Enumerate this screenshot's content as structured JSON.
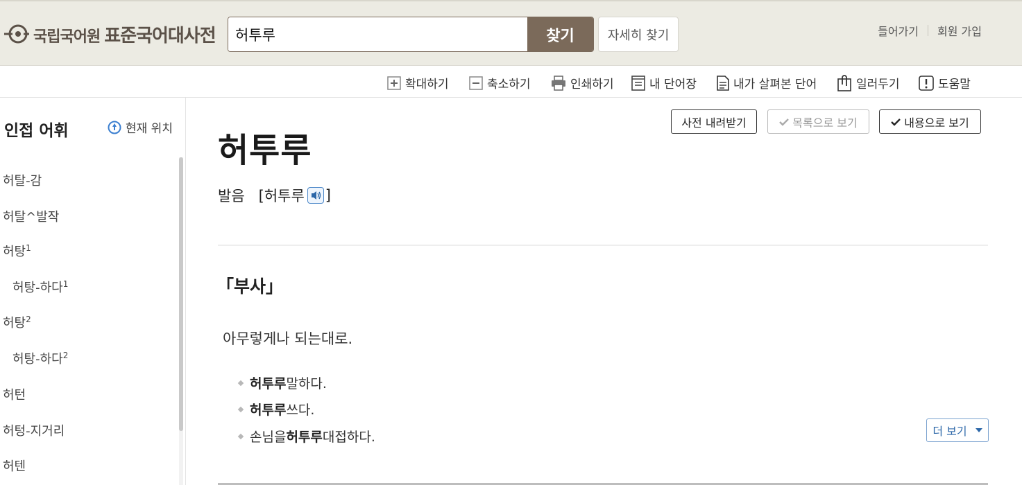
{
  "header": {
    "logo_org": "국립국어원",
    "logo_title": "표준국어대사전",
    "search_value": "허투루",
    "search_button": "찾기",
    "detail_search": "자세히 찾기",
    "login": "들어가기",
    "signup": "회원 가입"
  },
  "toolbar": {
    "zoom_in": "확대하기",
    "zoom_out": "축소하기",
    "print": "인쇄하기",
    "my_words": "내 단어장",
    "viewed_words": "내가 살펴본 단어",
    "notify": "일러두기",
    "help": "도움말"
  },
  "sidebar": {
    "title": "인접 어휘",
    "current_location": "현재 위치",
    "items": [
      {
        "text": "허탈-감",
        "sup": ""
      },
      {
        "text": "허탈^발작",
        "sup": ""
      },
      {
        "text": "허탕",
        "sup": "1"
      },
      {
        "text": "허탕-하다",
        "sup": "1"
      },
      {
        "text": "허탕",
        "sup": "2"
      },
      {
        "text": "허탕-하다",
        "sup": "2"
      },
      {
        "text": "허턴",
        "sup": ""
      },
      {
        "text": "허텅-지거리",
        "sup": ""
      },
      {
        "text": "허텐",
        "sup": ""
      }
    ]
  },
  "view_buttons": {
    "download": "사전 내려받기",
    "list_view": "목록으로 보기",
    "content_view": "내용으로 보기"
  },
  "entry": {
    "headword": "허투루",
    "pron_label": "발음",
    "pron_open": "[허투루",
    "pron_close": "]",
    "pos": "「부사」",
    "definition": "아무렇게나 되는대로.",
    "examples": [
      {
        "pre": "",
        "bold": "허투루",
        "post": " 말하다."
      },
      {
        "pre": "",
        "bold": "허투루",
        "post": " 쓰다."
      },
      {
        "pre": "손님을 ",
        "bold": "허투루",
        "post": " 대접하다."
      }
    ],
    "more": "더 보기"
  },
  "colors": {
    "header_bg": "#ecebe3",
    "brand_brown": "#7b6a5a",
    "link_blue": "#2c67a8"
  }
}
